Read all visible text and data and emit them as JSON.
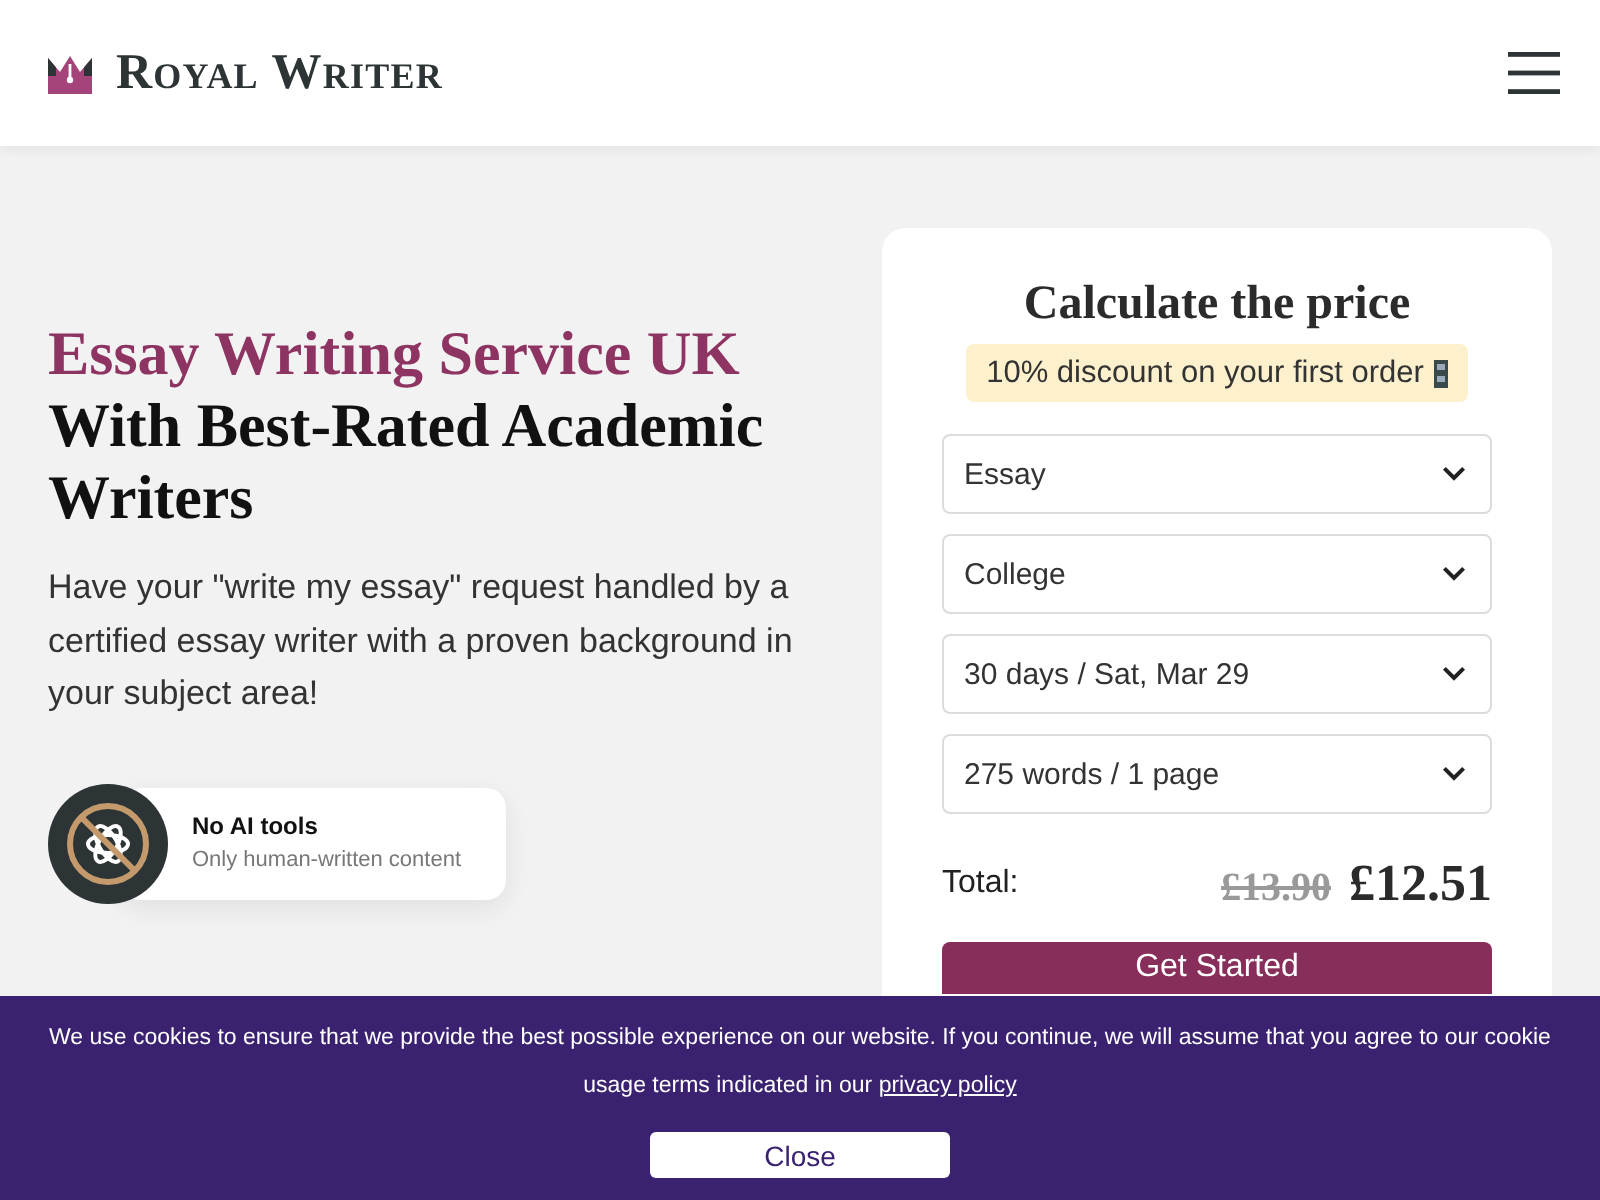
{
  "header": {
    "logo": "Royal Writer"
  },
  "hero": {
    "heading_highlight": "Essay Writing Service UK",
    "heading": "With Best-Rated Academic Writers",
    "description": "Have your \"write my essay\" request handled by a certified essay writer with a proven background in your subject area!",
    "badge": {
      "title": "No AI tools",
      "subtitle": "Only human-written content"
    }
  },
  "price_calculator": {
    "title": "Calculate the price",
    "discount": "10% discount on your first order",
    "selects": [
      {
        "value": "Essay"
      },
      {
        "value": "College"
      },
      {
        "value": "30 days / Sat, Mar 29"
      },
      {
        "value": "275 words / 1 page"
      }
    ],
    "total_label": "Total:",
    "old_price": "£13.90",
    "price": "£12.51",
    "button": "Get Started"
  },
  "cookie_banner": {
    "text": "We use cookies to ensure that we provide the best possible experience on our website. If you continue, we will assume that you agree to our cookie usage terms indicated in our",
    "link": "privacy policy",
    "button": "Close"
  }
}
